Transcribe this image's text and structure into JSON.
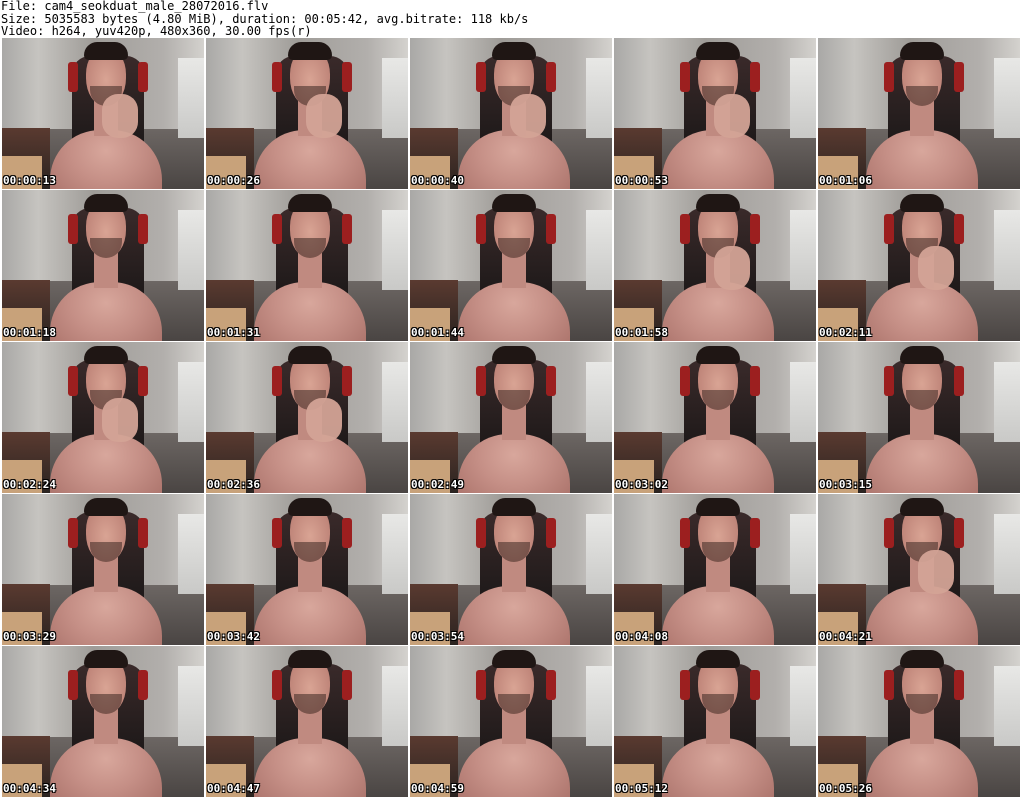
{
  "header": {
    "file_line": "File: cam4_seokduat_male_28072016.flv",
    "size_line": "Size: 5035583 bytes (4.80 MiB), duration: 00:05:42, avg.bitrate: 118 kb/s",
    "video_line": "Video: h264, yuv420p, 480x360, 30.00 fps(r)"
  },
  "grid": {
    "columns": 5,
    "rows": 5
  },
  "thumbnails": [
    {
      "timestamp": "00:00:13",
      "hand": true
    },
    {
      "timestamp": "00:00:26",
      "hand": true
    },
    {
      "timestamp": "00:00:40",
      "hand": true
    },
    {
      "timestamp": "00:00:53",
      "hand": true
    },
    {
      "timestamp": "00:01:06",
      "hand": false
    },
    {
      "timestamp": "00:01:18",
      "hand": false
    },
    {
      "timestamp": "00:01:31",
      "hand": false
    },
    {
      "timestamp": "00:01:44",
      "hand": false
    },
    {
      "timestamp": "00:01:58",
      "hand": true
    },
    {
      "timestamp": "00:02:11",
      "hand": true
    },
    {
      "timestamp": "00:02:24",
      "hand": true
    },
    {
      "timestamp": "00:02:36",
      "hand": true
    },
    {
      "timestamp": "00:02:49",
      "hand": false
    },
    {
      "timestamp": "00:03:02",
      "hand": false
    },
    {
      "timestamp": "00:03:15",
      "hand": false
    },
    {
      "timestamp": "00:03:29",
      "hand": false
    },
    {
      "timestamp": "00:03:42",
      "hand": false
    },
    {
      "timestamp": "00:03:54",
      "hand": false
    },
    {
      "timestamp": "00:04:08",
      "hand": false
    },
    {
      "timestamp": "00:04:21",
      "hand": true
    },
    {
      "timestamp": "00:04:34",
      "hand": false
    },
    {
      "timestamp": "00:04:47",
      "hand": false
    },
    {
      "timestamp": "00:04:59",
      "hand": false
    },
    {
      "timestamp": "00:05:12",
      "hand": false
    },
    {
      "timestamp": "00:05:26",
      "hand": false
    }
  ],
  "colors": {
    "background": "#ffffff",
    "text": "#000000",
    "timestamp_text": "#ffffff",
    "timestamp_outline": "#000000"
  }
}
